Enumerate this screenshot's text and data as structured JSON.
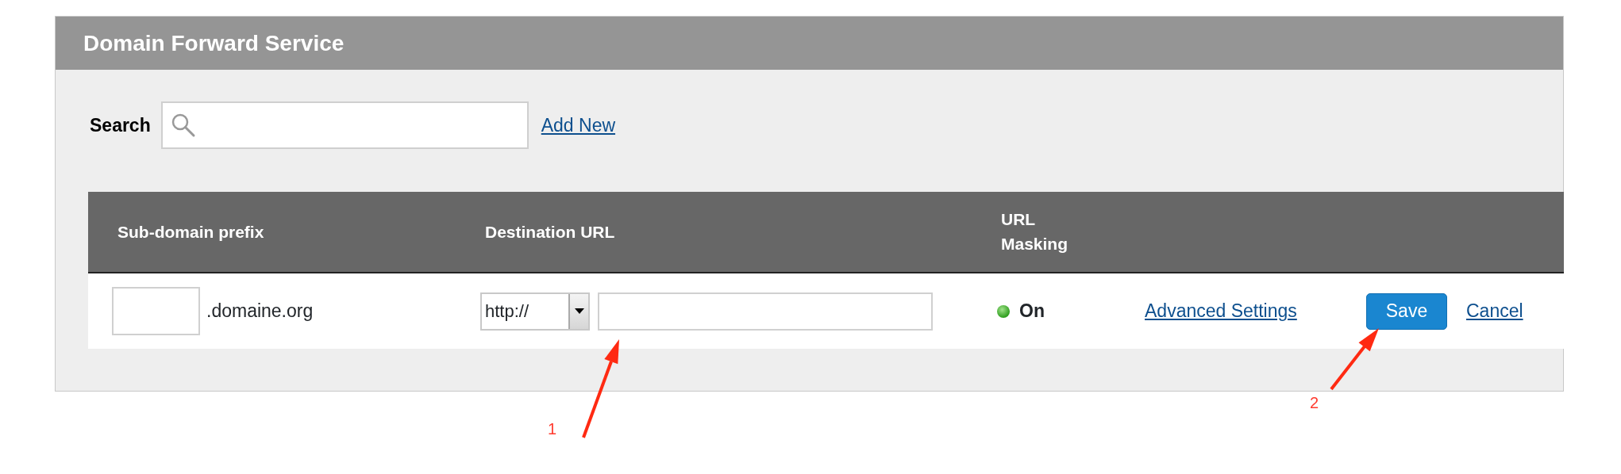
{
  "panel": {
    "title": "Domain Forward Service"
  },
  "search": {
    "label": "Search"
  },
  "add_new_link": "Add New",
  "table": {
    "columns": [
      "Sub-domain prefix",
      "Destination URL",
      "URL Masking"
    ],
    "rows": [
      {
        "subdomain_suffix": ".domaine.org",
        "protocol": "http://",
        "url_masking": {
          "on": true,
          "label": "On"
        },
        "advanced_link": "Advanced Settings",
        "save_button": "Save",
        "cancel_link": "Cancel"
      }
    ]
  },
  "annotations": [
    {
      "label": "1"
    },
    {
      "label": "2"
    }
  ]
}
